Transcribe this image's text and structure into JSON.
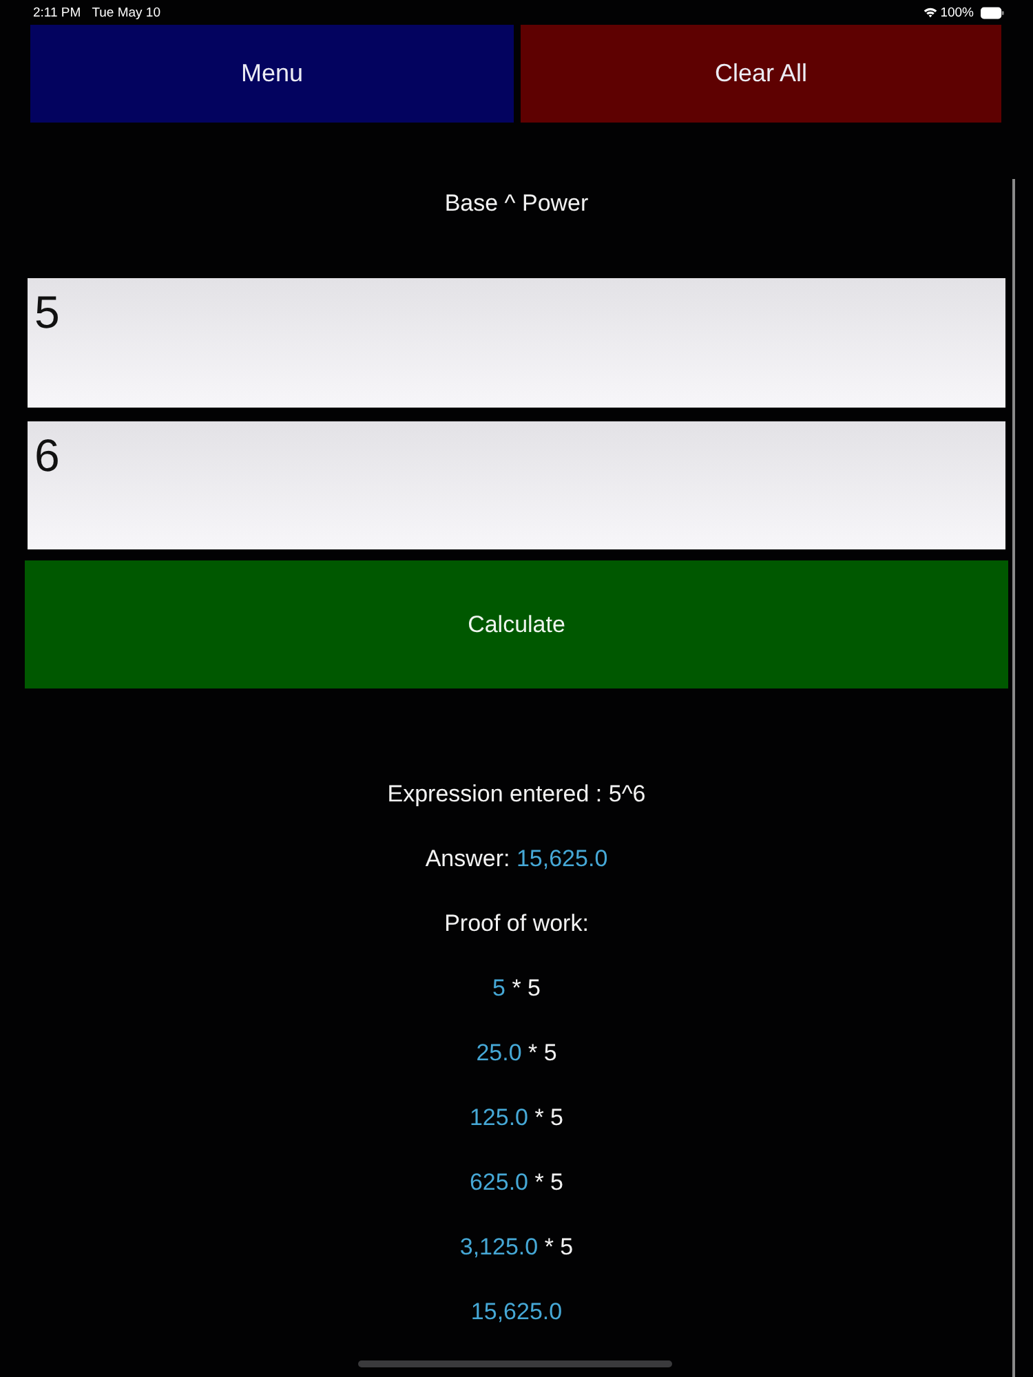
{
  "status_bar": {
    "time": "2:11 PM",
    "date": "Tue May 10",
    "battery": "100%"
  },
  "top_buttons": [
    {
      "label": "Menu",
      "kind": "menu"
    },
    {
      "label": "Clear All",
      "kind": "clear"
    }
  ],
  "title": "Base ^ Power",
  "inputs": [
    {
      "value": "5"
    },
    {
      "value": "6"
    }
  ],
  "calculate_button": {
    "label": "Calculate"
  },
  "result": {
    "expression": "Expression entered : 5^6",
    "answer_label": "Answer:",
    "answer_value": "15,625.0",
    "proof_label": "Proof of work:",
    "steps": [
      {
        "value": "5",
        "operation": "* 5"
      },
      {
        "value": "25.0",
        "operation": "* 5"
      },
      {
        "value": "125.0",
        "operation": "* 5"
      },
      {
        "value": "625.0",
        "operation": "* 5"
      },
      {
        "value": "3,125.0",
        "operation": "* 5"
      },
      {
        "value": "15,625.0"
      }
    ]
  }
}
